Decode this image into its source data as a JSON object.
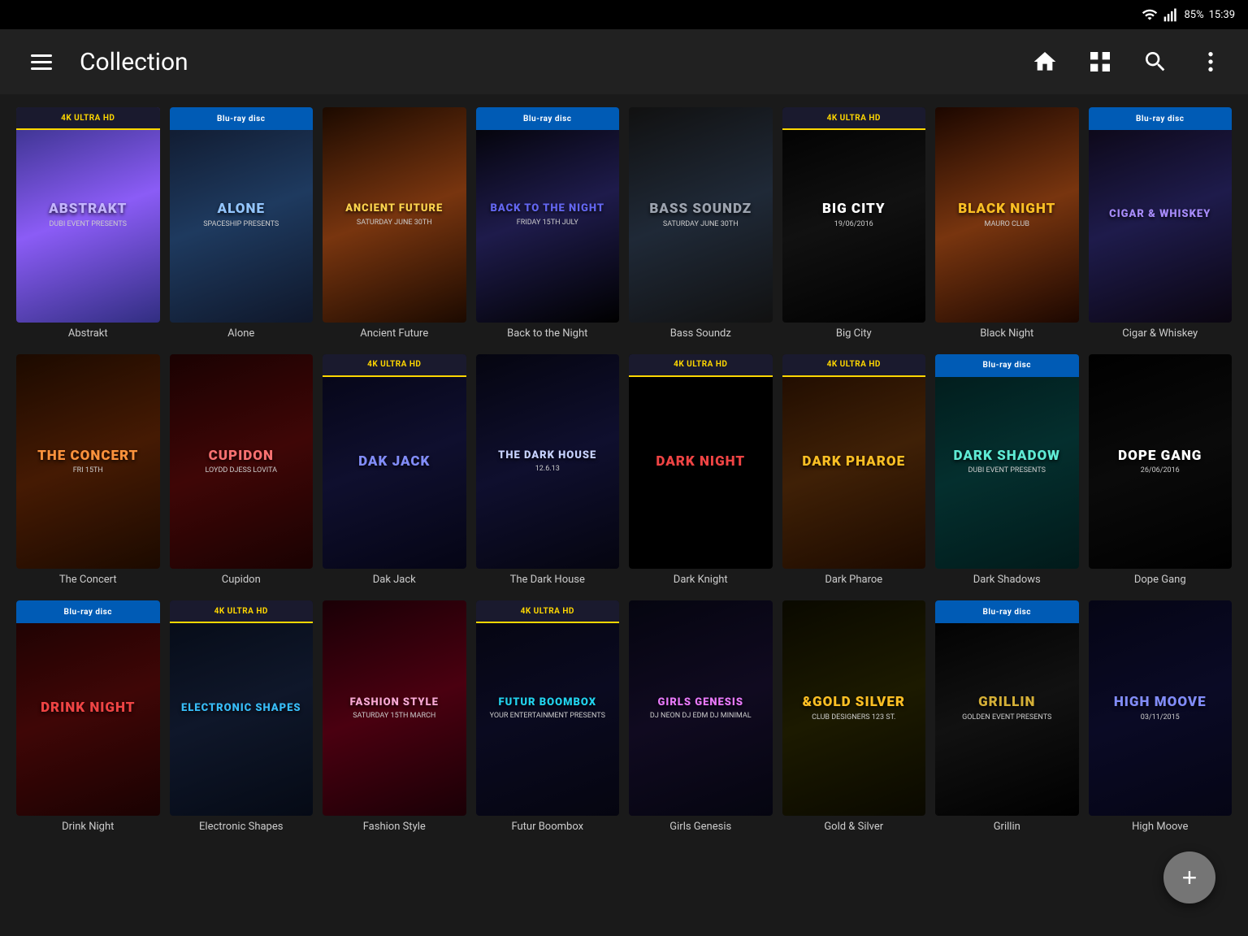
{
  "statusBar": {
    "wifi": "wifi",
    "signal": "signal",
    "battery": "85%",
    "time": "15:39"
  },
  "header": {
    "title": "Collection",
    "menuLabel": "menu",
    "homeLabel": "home",
    "gridLabel": "grid view",
    "searchLabel": "search",
    "moreLabel": "more options"
  },
  "fab": {
    "label": "+"
  },
  "rows": [
    {
      "items": [
        {
          "id": "abstrakt",
          "title": "Abstrakt",
          "badge": "4K",
          "badgeType": "4k",
          "color": "poster-abstrakt",
          "mainTitle": "ABSTRAKT",
          "sub": "DUBI EVENT PRESENTS"
        },
        {
          "id": "alone",
          "title": "Alone",
          "badge": "BD",
          "badgeType": "bluray",
          "color": "poster-alone",
          "mainTitle": "ALONE",
          "sub": "SPACESHIP PRESENTS"
        },
        {
          "id": "ancient-future",
          "title": "Ancient Future",
          "badge": "",
          "badgeType": "",
          "color": "poster-ancient-future",
          "mainTitle": "ANCIENT FUTURE",
          "sub": "SATURDAY JUNE 30TH"
        },
        {
          "id": "back-night",
          "title": "Back to the Night",
          "badge": "BD",
          "badgeType": "bluray",
          "color": "poster-back-night",
          "mainTitle": "BACK TO THE NIGHT",
          "sub": "FRIDAY 15TH JULY"
        },
        {
          "id": "bass-soundz",
          "title": "Bass Soundz",
          "badge": "",
          "badgeType": "",
          "color": "poster-bass-soundz",
          "mainTitle": "BASS SOUNDZ",
          "sub": "SATURDAY JUNE 30TH"
        },
        {
          "id": "big-city",
          "title": "Big City",
          "badge": "4K",
          "badgeType": "4k",
          "color": "poster-big-city",
          "mainTitle": "BIG CITY",
          "sub": "19/06/2016"
        },
        {
          "id": "black-night",
          "title": "Black Night",
          "badge": "",
          "badgeType": "",
          "color": "poster-black-night",
          "mainTitle": "BLACK NIGHT",
          "sub": "MAURO CLUB"
        },
        {
          "id": "cigar",
          "title": "Cigar & Whiskey",
          "badge": "BD",
          "badgeType": "bluray",
          "color": "poster-cigar",
          "mainTitle": "CIGAR & WHISKEY",
          "sub": ""
        }
      ]
    },
    {
      "items": [
        {
          "id": "concert",
          "title": "The Concert",
          "badge": "",
          "badgeType": "",
          "color": "poster-concert",
          "mainTitle": "THE CONCERT",
          "sub": "FRI 15TH"
        },
        {
          "id": "cupidon",
          "title": "Cupidon",
          "badge": "",
          "badgeType": "",
          "color": "poster-cupidon",
          "mainTitle": "CUPIDON",
          "sub": "LOYDD DJESS LOVITA"
        },
        {
          "id": "dak-jack",
          "title": "Dak Jack",
          "badge": "4K",
          "badgeType": "4k",
          "color": "poster-dak-jack",
          "mainTitle": "DAK JACK",
          "sub": ""
        },
        {
          "id": "dark-house",
          "title": "The Dark House",
          "badge": "",
          "badgeType": "",
          "color": "poster-dark-house",
          "mainTitle": "THE DARK HOUSE",
          "sub": "12.6.13"
        },
        {
          "id": "dark-knight",
          "title": "Dark Knight",
          "badge": "4K",
          "badgeType": "4k",
          "color": "poster-dark-knight",
          "mainTitle": "DARK NIGHT",
          "sub": ""
        },
        {
          "id": "dark-pharoe",
          "title": "Dark Pharoe",
          "badge": "4K",
          "badgeType": "4k",
          "color": "poster-dark-pharoe",
          "mainTitle": "DARK PHAROE",
          "sub": ""
        },
        {
          "id": "dark-shadows",
          "title": "Dark Shadows",
          "badge": "BD",
          "badgeType": "bluray",
          "color": "poster-dark-shadows",
          "mainTitle": "DARK SHADOW",
          "sub": "DUBI EVENT PRESENTS"
        },
        {
          "id": "dope-gang",
          "title": "Dope Gang",
          "badge": "",
          "badgeType": "",
          "color": "poster-dope-gang",
          "mainTitle": "DOPE GANG",
          "sub": "26/06/2016"
        }
      ]
    },
    {
      "items": [
        {
          "id": "drink-night",
          "title": "Drink Night",
          "badge": "BD",
          "badgeType": "bluray",
          "color": "poster-drink-night",
          "mainTitle": "DRINK NIGHT",
          "sub": ""
        },
        {
          "id": "electronic",
          "title": "Electronic Shapes",
          "badge": "4K",
          "badgeType": "4k",
          "color": "poster-electronic",
          "mainTitle": "Electronic Shapes",
          "sub": ""
        },
        {
          "id": "fashion",
          "title": "Fashion Style",
          "badge": "",
          "badgeType": "",
          "color": "poster-fashion",
          "mainTitle": "Fashion Style",
          "sub": "SATURDAY 15TH MARCH"
        },
        {
          "id": "futur",
          "title": "Futur Boombox",
          "badge": "4K",
          "badgeType": "4k",
          "color": "poster-futur",
          "mainTitle": "FUTUR Boombox",
          "sub": "YOUR ENTERTAINMENT PRESENTS"
        },
        {
          "id": "girls",
          "title": "Girls Genesis",
          "badge": "",
          "badgeType": "",
          "color": "poster-girls",
          "mainTitle": "GIRLS Genesis",
          "sub": "DJ NEON DJ EDM DJ MINIMAL"
        },
        {
          "id": "gold",
          "title": "Gold & Silver",
          "badge": "",
          "badgeType": "",
          "color": "poster-gold",
          "mainTitle": "&Gold Silver",
          "sub": "CLUB DESIGNERS 123 ST."
        },
        {
          "id": "grillin",
          "title": "Grillin",
          "badge": "BD",
          "badgeType": "bluray",
          "color": "poster-grillin",
          "mainTitle": "Grillin",
          "sub": "GOLDEN EVENT PRESENTS"
        },
        {
          "id": "high",
          "title": "High Moove",
          "badge": "",
          "badgeType": "",
          "color": "poster-high",
          "mainTitle": "HIGH MOOVE",
          "sub": "03/11/2015"
        }
      ]
    }
  ]
}
